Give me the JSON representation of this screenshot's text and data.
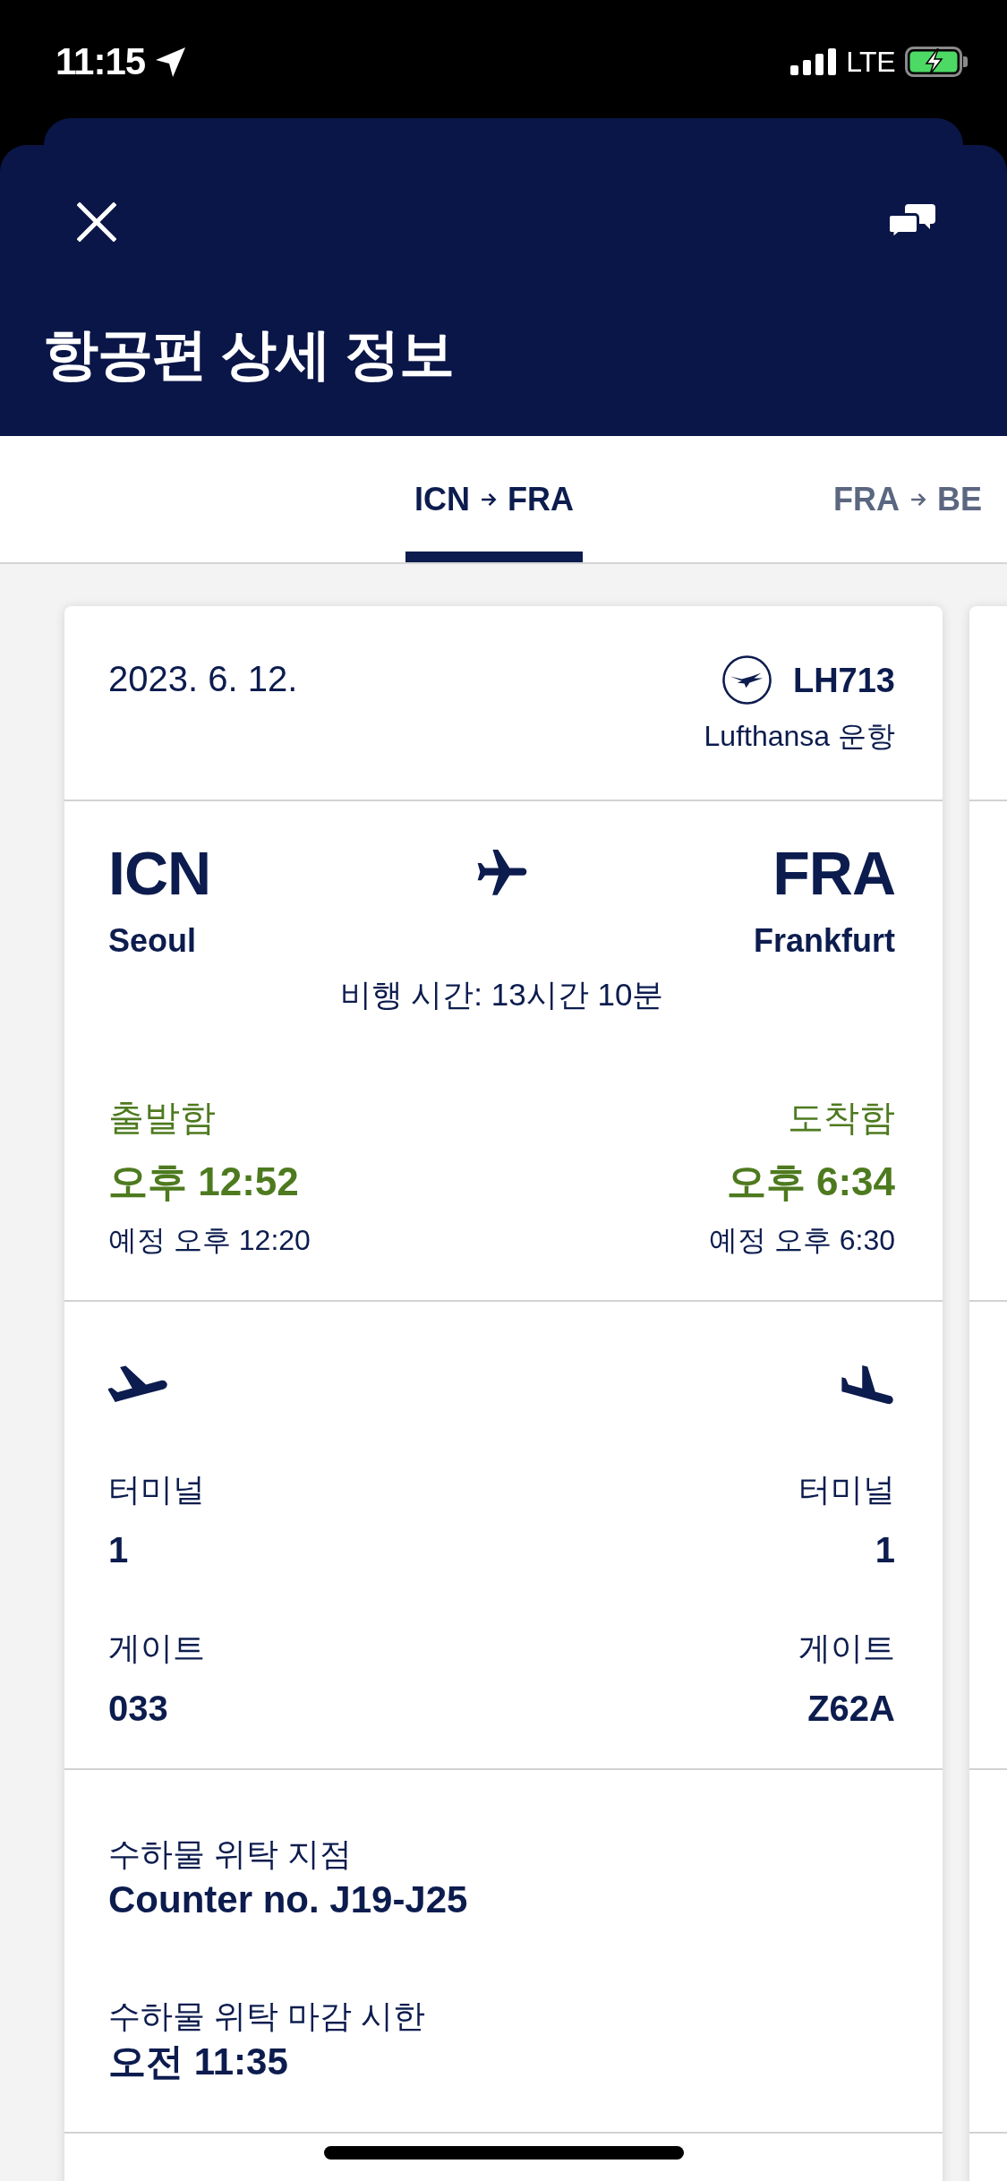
{
  "status_bar": {
    "time": "11:15",
    "network": "LTE"
  },
  "header": {
    "title": "항공편 상세 정보"
  },
  "tabs": [
    {
      "from": "ICN",
      "to": "FRA",
      "selected": true
    },
    {
      "from": "FRA",
      "to": "BE",
      "selected": false
    }
  ],
  "flight": {
    "date": "2023. 6. 12.",
    "flight_number": "LH713",
    "operator": "Lufthansa 운항",
    "route": [
      {
        "code": "ICN",
        "city": "Seoul"
      },
      {
        "code": "FRA",
        "city": "Frankfurt"
      }
    ],
    "duration": "비행 시간: 13시간 10분",
    "times": [
      {
        "status": "출발함",
        "actual": "오후 12:52",
        "scheduled": "예정 오후 12:20"
      },
      {
        "status": "도착함",
        "actual": "오후 6:34",
        "scheduled": "예정 오후 6:30"
      }
    ],
    "airports": [
      {
        "kind": "takeoff",
        "terminal_label": "터미널",
        "terminal": "1",
        "gate_label": "게이트",
        "gate": "033"
      },
      {
        "kind": "landing",
        "terminal_label": "터미널",
        "terminal": "1",
        "gate_label": "게이트",
        "gate": "Z62A"
      }
    ],
    "baggage": [
      {
        "label": "수하물 위탁 지점",
        "value": "Counter no. J19-J25"
      },
      {
        "label": "수하물 위탁 마감 시한",
        "value": "오전 11:35"
      }
    ]
  }
}
